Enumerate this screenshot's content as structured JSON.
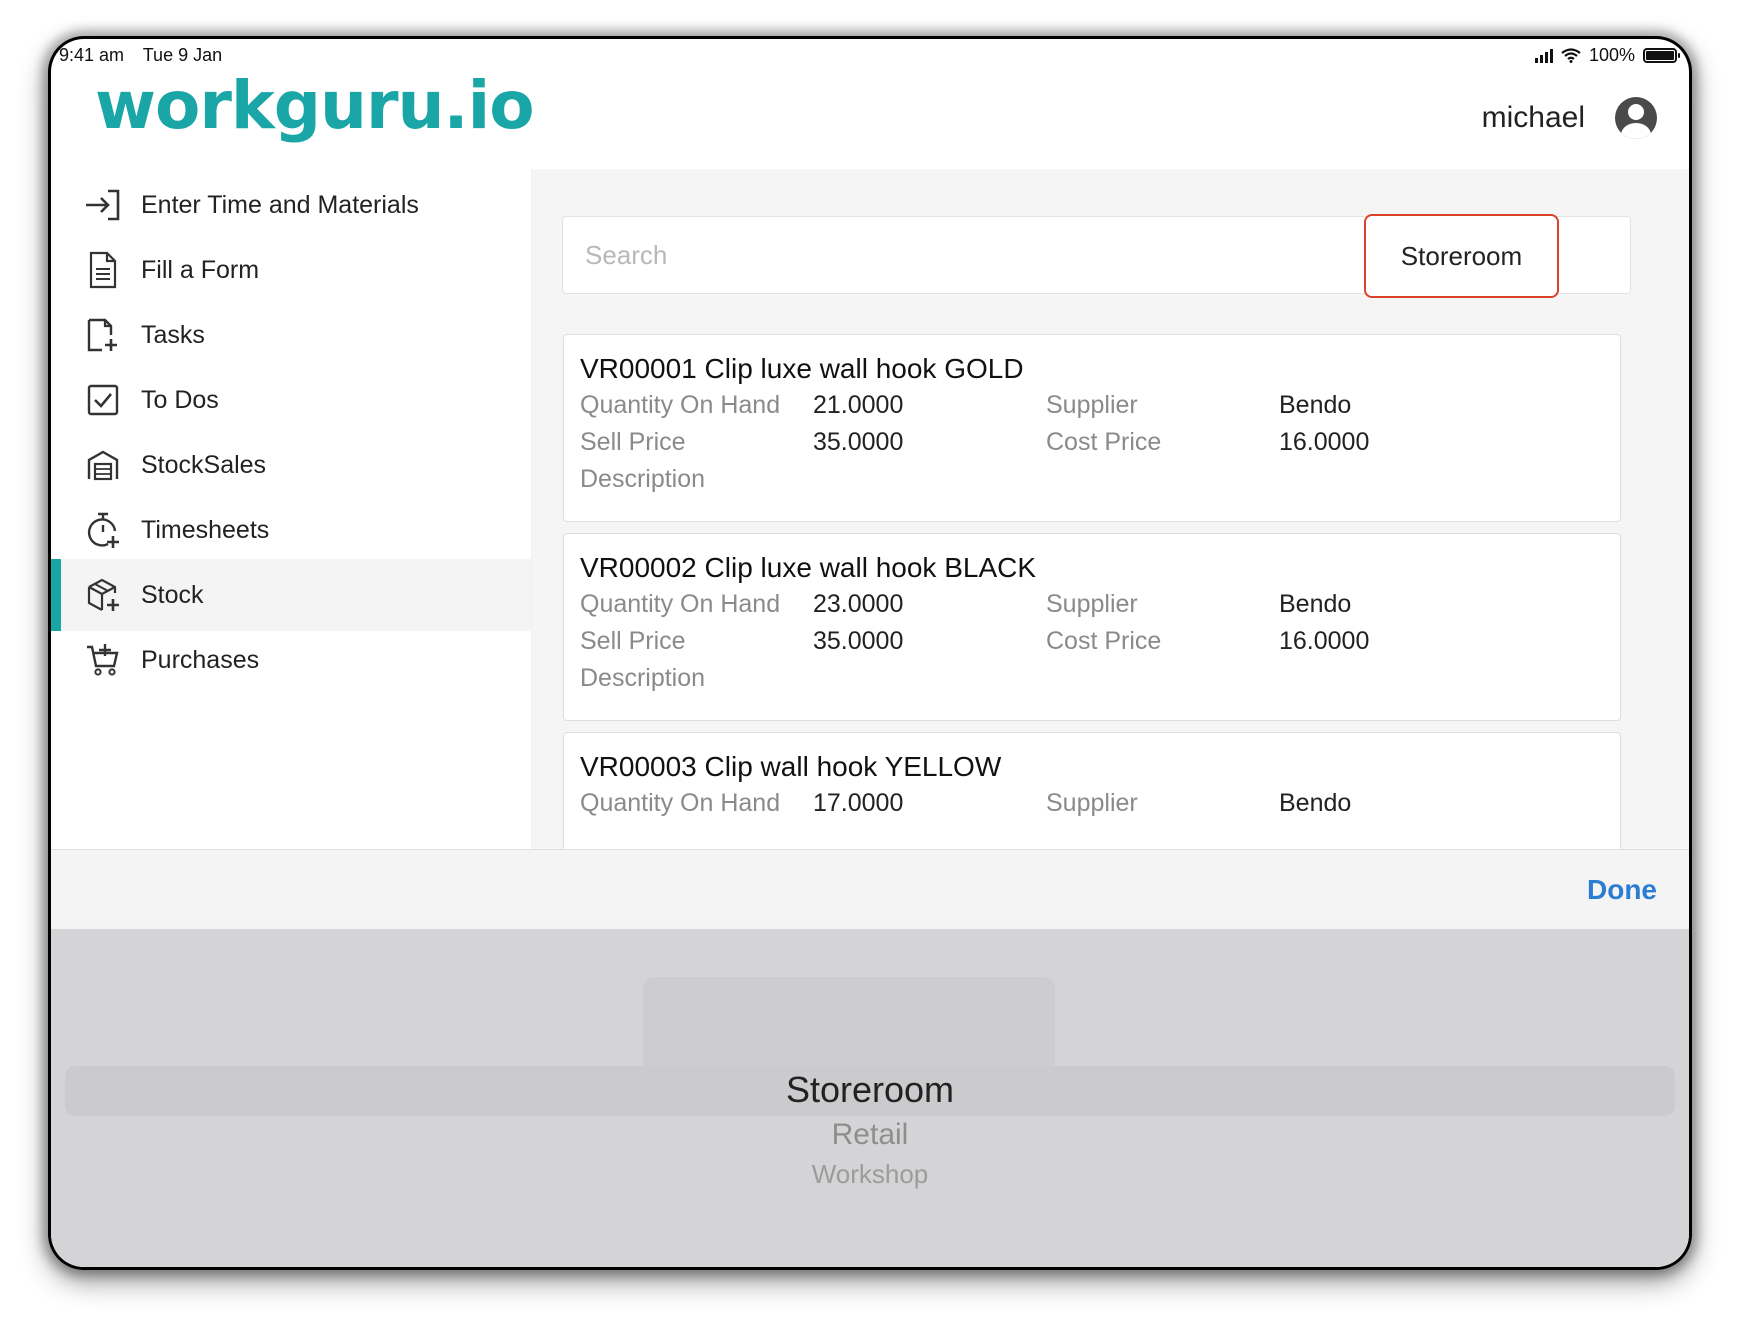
{
  "status_bar": {
    "time": "9:41 am",
    "date": "Tue 9 Jan",
    "battery": "100%"
  },
  "header": {
    "logo": "workguru.io",
    "username": "michael"
  },
  "sidebar": {
    "items": [
      {
        "label": "Enter Time and Materials",
        "icon": "enter-arrow-icon"
      },
      {
        "label": "Fill a Form",
        "icon": "document-icon"
      },
      {
        "label": "Tasks",
        "icon": "task-add-icon"
      },
      {
        "label": "To Dos",
        "icon": "checkbox-icon"
      },
      {
        "label": "StockSales",
        "icon": "store-icon"
      },
      {
        "label": "Timesheets",
        "icon": "stopwatch-icon"
      },
      {
        "label": "Stock",
        "icon": "box-add-icon",
        "active": true
      },
      {
        "label": "Purchases",
        "icon": "cart-add-icon"
      }
    ]
  },
  "search": {
    "placeholder": "Search",
    "location": "Storeroom"
  },
  "field_labels": {
    "qty": "Quantity On Hand",
    "sell": "Sell Price",
    "desc": "Description",
    "supplier": "Supplier",
    "cost": "Cost Price"
  },
  "stock_items": [
    {
      "code": "VR00001",
      "name": "Clip luxe wall hook GOLD",
      "qty": "21.0000",
      "sell": "35.0000",
      "supplier": "Bendo",
      "cost": "16.0000"
    },
    {
      "code": "VR00002",
      "name": "Clip luxe wall hook BLACK",
      "qty": "23.0000",
      "sell": "35.0000",
      "supplier": "Bendo",
      "cost": "16.0000"
    },
    {
      "code": "VR00003",
      "name": "Clip wall hook YELLOW",
      "qty": "17.0000",
      "sell": "",
      "supplier": "Bendo",
      "cost": ""
    }
  ],
  "toolbar": {
    "done_label": "Done"
  },
  "picker": {
    "options": [
      "Storeroom",
      "Retail",
      "Workshop"
    ],
    "selected": "Storeroom"
  },
  "colors": {
    "accent": "#1aa6a6",
    "highlight_border": "#d9432e",
    "done": "#2b7cd3"
  }
}
